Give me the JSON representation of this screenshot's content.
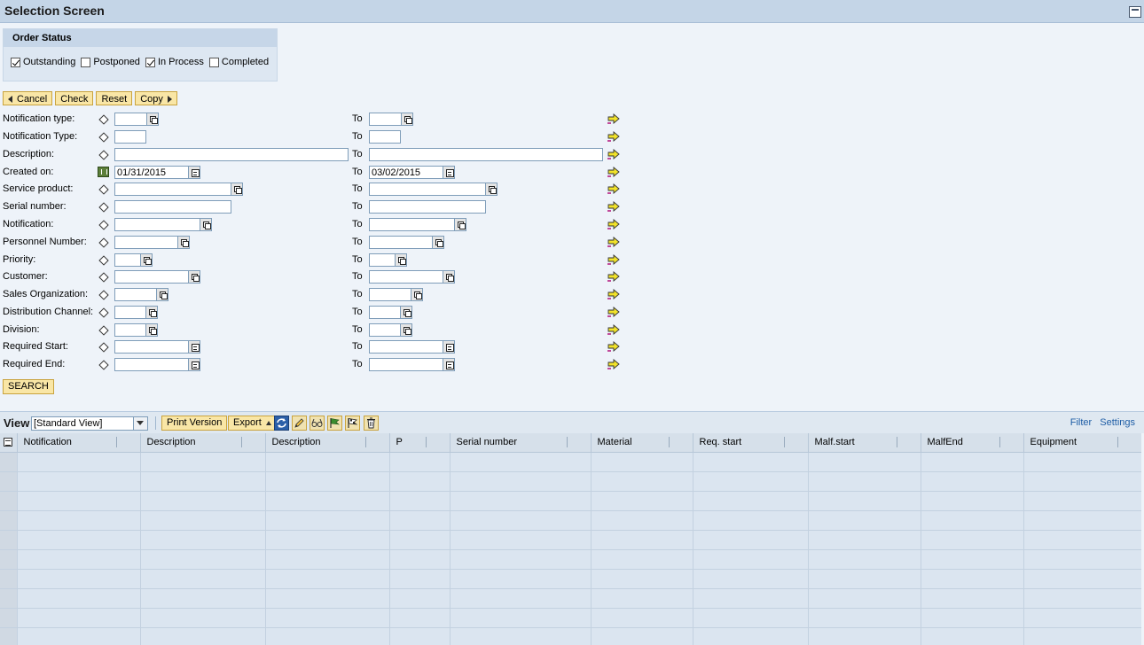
{
  "window": {
    "title": "Selection Screen"
  },
  "order_status": {
    "header": "Order Status",
    "options": [
      {
        "label": "Outstanding",
        "checked": true
      },
      {
        "label": "Postponed",
        "checked": false
      },
      {
        "label": "In Process",
        "checked": true
      },
      {
        "label": "Completed",
        "checked": false
      }
    ]
  },
  "actions": {
    "cancel": "Cancel",
    "check": "Check",
    "reset": "Reset",
    "copy": "Copy"
  },
  "fields": {
    "to_label": "To",
    "rows": [
      {
        "label": "Notification type:",
        "from": "",
        "to": ""
      },
      {
        "label": "Notification Type:",
        "from": "",
        "to": ""
      },
      {
        "label": "Description:",
        "from": "",
        "to": ""
      },
      {
        "label": "Created on:",
        "from": "01/31/2015",
        "to": "03/02/2015"
      },
      {
        "label": "Service product:",
        "from": "",
        "to": ""
      },
      {
        "label": "Serial number:",
        "from": "",
        "to": ""
      },
      {
        "label": "Notification:",
        "from": "",
        "to": ""
      },
      {
        "label": "Personnel Number:",
        "from": "",
        "to": ""
      },
      {
        "label": "Priority:",
        "from": "",
        "to": ""
      },
      {
        "label": "Customer:",
        "from": "",
        "to": ""
      },
      {
        "label": "Sales Organization:",
        "from": "",
        "to": ""
      },
      {
        "label": "Distribution Channel:",
        "from": "",
        "to": ""
      },
      {
        "label": "Division:",
        "from": "",
        "to": ""
      },
      {
        "label": "Required Start:",
        "from": "",
        "to": ""
      },
      {
        "label": "Required End:",
        "from": "",
        "to": ""
      }
    ]
  },
  "search": {
    "label": "SEARCH"
  },
  "view": {
    "label": "View",
    "selected": "[Standard View]",
    "print_version": "Print Version",
    "export": "Export",
    "filter": "Filter",
    "settings": "Settings"
  },
  "table": {
    "columns": [
      "Notification",
      "Description",
      "Description",
      "P",
      "Serial number",
      "Material",
      "Req. start",
      "Malf.start",
      "MalfEnd",
      "Equipment"
    ],
    "empty_rows": 10
  }
}
